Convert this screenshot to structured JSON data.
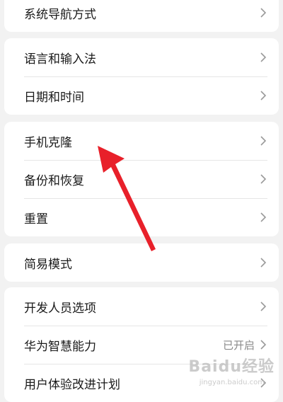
{
  "groups": [
    {
      "items": [
        {
          "label": "系统导航方式"
        }
      ]
    },
    {
      "items": [
        {
          "label": "语言和输入法"
        },
        {
          "label": "日期和时间"
        }
      ]
    },
    {
      "items": [
        {
          "label": "手机克隆"
        },
        {
          "label": "备份和恢复"
        },
        {
          "label": "重置"
        }
      ]
    },
    {
      "items": [
        {
          "label": "简易模式"
        }
      ]
    },
    {
      "items": [
        {
          "label": "开发人员选项"
        },
        {
          "label": "华为智慧能力",
          "value": "已开启"
        },
        {
          "label": "用户体验改进计划"
        }
      ]
    }
  ],
  "icons": {
    "row_arrow": "chevron-right-icon",
    "annotation": "red-arrow-annotation"
  },
  "colors": {
    "background": "#f2f2f2",
    "card": "#ffffff",
    "divider": "#e6e6e6",
    "annotation": "#e8202a"
  },
  "watermark": {
    "text": "Baidu经验",
    "sub": "jingyan.baidu.com"
  }
}
